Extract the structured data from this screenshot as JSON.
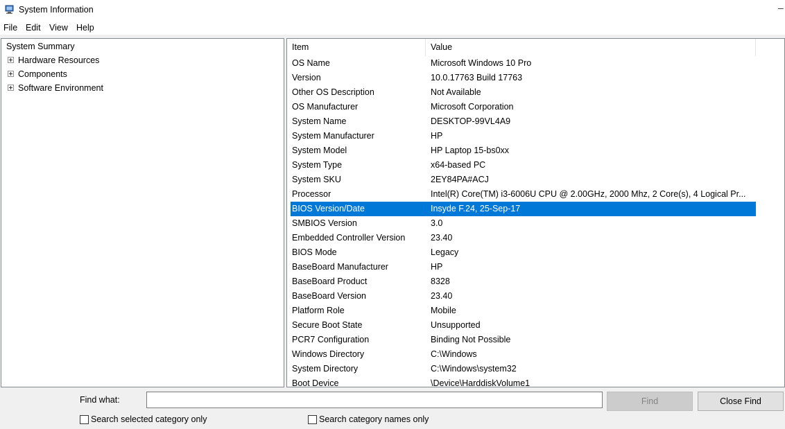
{
  "window": {
    "title": "System Information",
    "icon": "system-information-icon",
    "minimize_glyph": "–"
  },
  "menu": [
    "File",
    "Edit",
    "View",
    "Help"
  ],
  "tree": {
    "root": "System Summary",
    "children": [
      "Hardware Resources",
      "Components",
      "Software Environment"
    ]
  },
  "table": {
    "columns": {
      "item": "Item",
      "value": "Value"
    },
    "selected_index": 10,
    "rows": [
      {
        "item": "OS Name",
        "value": "Microsoft Windows 10 Pro"
      },
      {
        "item": "Version",
        "value": "10.0.17763 Build 17763"
      },
      {
        "item": "Other OS Description",
        "value": "Not Available"
      },
      {
        "item": "OS Manufacturer",
        "value": "Microsoft Corporation"
      },
      {
        "item": "System Name",
        "value": "DESKTOP-99VL4A9"
      },
      {
        "item": "System Manufacturer",
        "value": "HP"
      },
      {
        "item": "System Model",
        "value": "HP Laptop 15-bs0xx"
      },
      {
        "item": "System Type",
        "value": "x64-based PC"
      },
      {
        "item": "System SKU",
        "value": "2EY84PA#ACJ"
      },
      {
        "item": "Processor",
        "value": "Intel(R) Core(TM) i3-6006U CPU @ 2.00GHz, 2000 Mhz, 2 Core(s), 4 Logical Pr..."
      },
      {
        "item": "BIOS Version/Date",
        "value": "Insyde F.24, 25-Sep-17"
      },
      {
        "item": "SMBIOS Version",
        "value": "3.0"
      },
      {
        "item": "Embedded Controller Version",
        "value": "23.40"
      },
      {
        "item": "BIOS Mode",
        "value": "Legacy"
      },
      {
        "item": "BaseBoard Manufacturer",
        "value": "HP"
      },
      {
        "item": "BaseBoard Product",
        "value": "8328"
      },
      {
        "item": "BaseBoard Version",
        "value": "23.40"
      },
      {
        "item": "Platform Role",
        "value": "Mobile"
      },
      {
        "item": "Secure Boot State",
        "value": "Unsupported"
      },
      {
        "item": "PCR7 Configuration",
        "value": "Binding Not Possible"
      },
      {
        "item": "Windows Directory",
        "value": "C:\\Windows"
      },
      {
        "item": "System Directory",
        "value": "C:\\Windows\\system32"
      },
      {
        "item": "Boot Device",
        "value": "\\Device\\HarddiskVolume1"
      }
    ]
  },
  "find": {
    "label": "Find what:",
    "value": "",
    "find_button": "Find",
    "close_button": "Close Find",
    "search_selected_label": "Search selected category only",
    "search_selected_checked": false,
    "search_names_label": "Search category names only",
    "search_names_checked": false
  },
  "colors": {
    "selection": "#0078d7",
    "selection_text": "#ffffff",
    "background": "#f0f0f0"
  }
}
